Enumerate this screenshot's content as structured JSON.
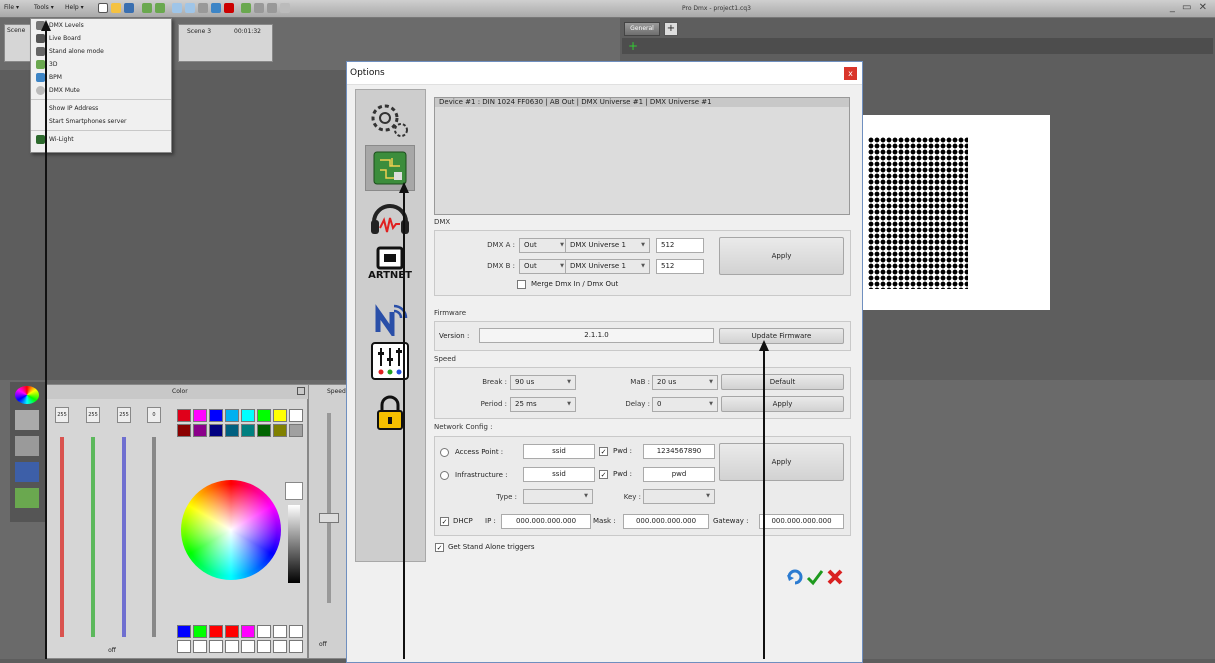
{
  "app": {
    "title": "Pro Dmx - project1.cq3",
    "menus": [
      "File ▾",
      "Tools ▾",
      "Help ▾"
    ],
    "window_controls": "_ ▭ ✕"
  },
  "tools_menu": {
    "items": [
      "DMX Levels",
      "Live Board",
      "Stand alone mode",
      "3D",
      "BPM",
      "DMX Mute",
      "Show IP Address",
      "Start Smartphones server",
      "Wi-Light"
    ]
  },
  "scenes": {
    "label": "Scene",
    "scene3": "Scene 3",
    "time": "00:01:32"
  },
  "right_panel": {
    "tab": "General"
  },
  "dialog": {
    "title": "Options",
    "close": "x",
    "nav": {
      "artnet_label": "ARTNET"
    },
    "device_row": "Device #1 : DIN 1024 FF0630 | AB Out | DMX Universe #1 | DMX Universe #1",
    "dmx": {
      "section": "DMX",
      "a_label": "DMX A :",
      "b_label": "DMX B :",
      "a_mode": "Out",
      "b_mode": "Out",
      "a_universe": "DMX Universe 1",
      "b_universe": "DMX Universe 1",
      "a_channels": "512",
      "b_channels": "512",
      "apply": "Apply",
      "merge_label": "Merge Dmx In / Dmx Out"
    },
    "firmware": {
      "section": "Firmware",
      "version_label": "Version :",
      "version": "2.1.1.0",
      "update_button": "Update Firmware"
    },
    "speed": {
      "section": "Speed",
      "break_label": "Break :",
      "break_value": "90 us",
      "mab_label": "MaB :",
      "mab_value": "20 us",
      "default_button": "Default",
      "period_label": "Period :",
      "period_value": "25 ms",
      "delay_label": "Delay :",
      "delay_value": "0",
      "apply": "Apply"
    },
    "network": {
      "section": "Network Config :",
      "ap_label": "Access Point :",
      "ap_ssid": "ssid",
      "ap_pwd_label": "Pwd :",
      "ap_pwd": "1234567890",
      "infra_label": "Infrastructure :",
      "infra_ssid": "ssid",
      "infra_pwd_label": "Pwd :",
      "infra_pwd": "pwd",
      "apply": "Apply",
      "type_label": "Type :",
      "key_label": "Key :",
      "dhcp_label": "DHCP",
      "ip_label": "IP :",
      "ip": "000.000.000.000",
      "mask_label": "Mask :",
      "mask": "000.000.000.000",
      "gateway_label": "Gateway :",
      "gateway": "000.000.000.000"
    },
    "standalone_triggers": "Get Stand Alone triggers"
  },
  "color_panel": {
    "title": "Color",
    "speed_label": "Speed",
    "fader_values": [
      "255",
      "255",
      "255",
      "0"
    ],
    "off_labels": [
      "off",
      "off",
      "off"
    ],
    "swatches_top": [
      "#e0001a",
      "#ff00ff",
      "#0000ff",
      "#00b0f0",
      "#00ffff",
      "#00ff00",
      "#ffff00",
      "#ffffff"
    ],
    "swatches_mid": [
      "#8b0000",
      "#8b008b",
      "#000080",
      "#006080",
      "#008080",
      "#006400",
      "#808000",
      "#a0a0a0"
    ],
    "swatches_bottom": [
      "#0000ff",
      "#00ff00",
      "#ff0000",
      "#ff0000",
      "#ff00ff",
      "#ffffff",
      "#ffffff",
      "#ffffff"
    ],
    "swatches_bottom2": [
      "#ffffff",
      "#ffffff",
      "#ffffff",
      "#ffffff",
      "#ffffff",
      "#ffffff",
      "#ffffff",
      "#ffffff"
    ]
  }
}
